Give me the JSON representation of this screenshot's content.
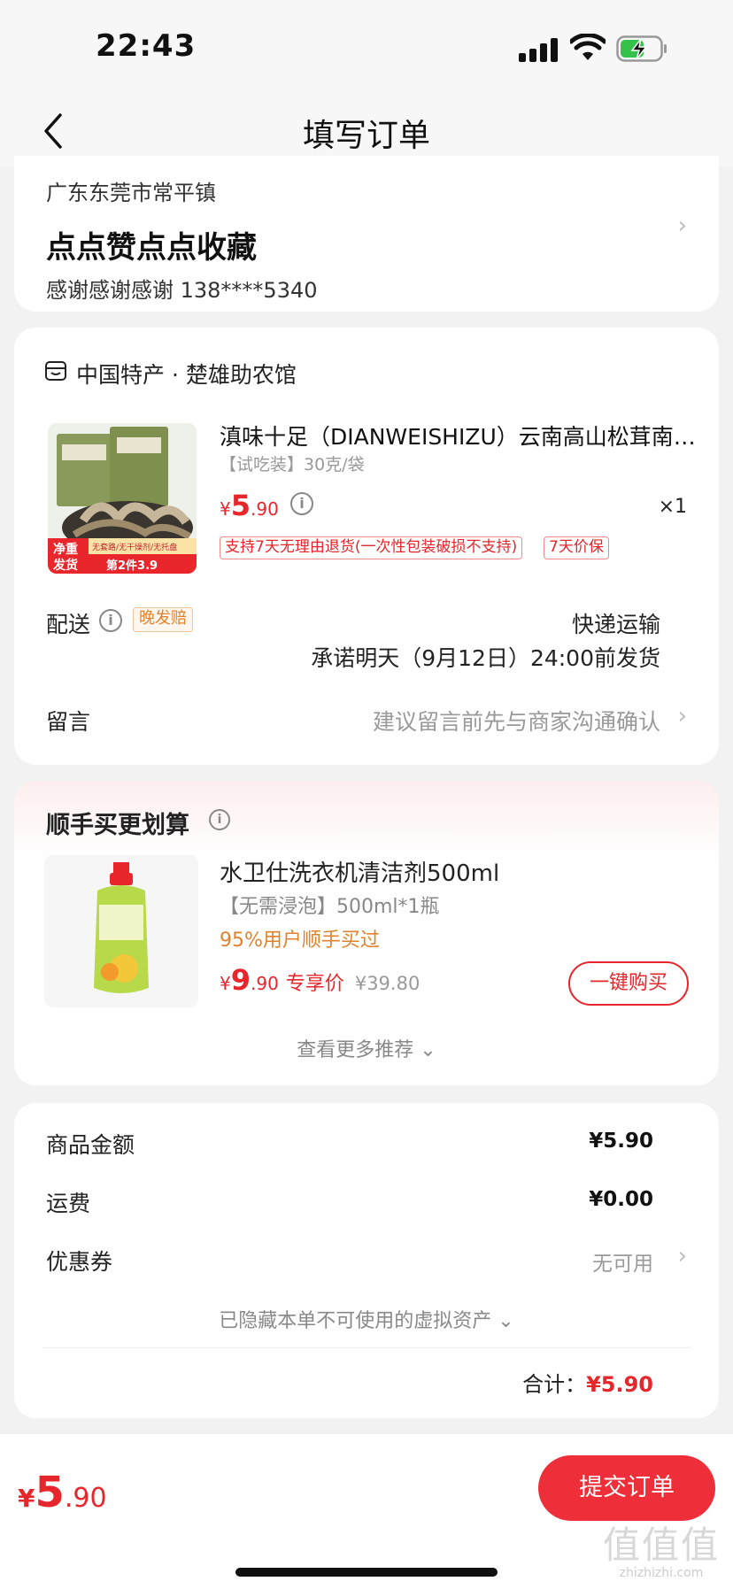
{
  "status_bar": {
    "time": "22:43"
  },
  "nav": {
    "title": "填写订单"
  },
  "address": {
    "region": "广东东莞市常平镇",
    "name": "点点赞点点收藏",
    "contact": "感谢感谢感谢  138****5340"
  },
  "order": {
    "store_name": "中国特产 · 楚雄助农馆",
    "product_title": "滇味十足（DIANWEISHIZU）云南高山松茸南…",
    "product_spec": "【试吃装】30克/袋",
    "price_yen": "¥",
    "price_int": "5",
    "price_dec": ".90",
    "quantity": "×1",
    "img_badge_left_1": "净重",
    "img_badge_left_2": "发货",
    "img_badge_top": "无套路/无干燥剂/无托盘",
    "img_badge_bottom": "第2件3.9",
    "tags": [
      "支持7天无理由退货(一次性包装破损不支持)",
      "7天价保"
    ],
    "delivery_label": "配送",
    "late_badge": "晚发赔",
    "ship_method": "快递运输",
    "ship_promise": "承诺明天（9月12日）24:00前发货",
    "note_label": "留言",
    "note_hint": "建议留言前先与商家沟通确认"
  },
  "recommend": {
    "title": "顺手买更划算",
    "name": "水卫仕洗衣机清洁剂500ml",
    "spec": "【无需浸泡】500ml*1瓶",
    "social": "95%用户顺手买过",
    "price_yen": "¥",
    "price_int": "9",
    "price_dec": ".90",
    "exclusive": "专享价",
    "orig_price": "¥39.80",
    "buy_label": "一键购买",
    "more_label": "查看更多推荐 ⌄"
  },
  "summary": {
    "goods_label": "商品金额",
    "goods_value": "¥5.90",
    "freight_label": "运费",
    "freight_value": "¥0.00",
    "coupon_label": "优惠券",
    "coupon_value": "无可用",
    "hidden_assets": "已隐藏本单不可使用的虚拟资产 ⌄",
    "total_label": "合计：",
    "total_value": "¥5.90"
  },
  "bottom": {
    "price_yen": "¥",
    "price_int": "5",
    "price_dec": ".90",
    "submit_label": "提交订单",
    "watermark_symbol": "值值值",
    "watermark_url": "zhizhizhi.com"
  },
  "colors": {
    "accent_red": "#e6262b",
    "submit_red": "#ee2f3a",
    "orange": "#e0822d"
  },
  "icons": [
    "back-chevron",
    "signal",
    "wifi",
    "battery-charging",
    "store",
    "info",
    "chevron-right"
  ]
}
